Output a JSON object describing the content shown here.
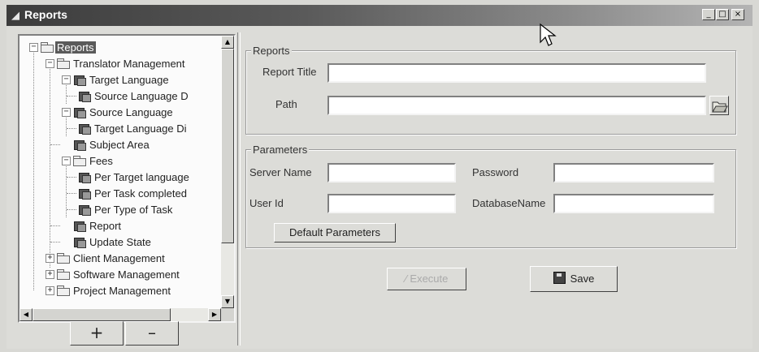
{
  "window": {
    "title": "Reports",
    "controls": [
      "minimize",
      "maximize",
      "close"
    ]
  },
  "tree": {
    "items": [
      {
        "label": "Reports",
        "icon": "folder-icon",
        "selected": true
      },
      {
        "label": "Translator Management",
        "icon": "folder-icon"
      },
      {
        "label": "Target Language",
        "icon": "report-icon"
      },
      {
        "label": "Source Language D",
        "icon": "report-icon"
      },
      {
        "label": "Source Language",
        "icon": "report-icon"
      },
      {
        "label": "Target Language Di",
        "icon": "report-icon"
      },
      {
        "label": "Subject Area",
        "icon": "report-icon"
      },
      {
        "label": "Fees",
        "icon": "folder-icon"
      },
      {
        "label": "Per Target language",
        "icon": "report-icon"
      },
      {
        "label": "Per Task completed",
        "icon": "report-icon"
      },
      {
        "label": "Per Type of Task",
        "icon": "report-icon"
      },
      {
        "label": "Report",
        "icon": "report-icon"
      },
      {
        "label": "Update State",
        "icon": "report-icon"
      },
      {
        "label": "Client Management",
        "icon": "folder-icon"
      },
      {
        "label": "Software Management",
        "icon": "folder-icon"
      },
      {
        "label": "Project Management",
        "icon": "folder-icon"
      }
    ],
    "add_label": "+",
    "remove_label": "–"
  },
  "reports_group": {
    "legend": "Reports",
    "report_title_label": "Report Title",
    "report_title_value": "",
    "path_label": "Path",
    "path_value": ""
  },
  "parameters_group": {
    "legend": "Parameters",
    "server_name_label": "Server Name",
    "server_name_value": "",
    "password_label": "Password",
    "password_value": "",
    "user_id_label": "User Id",
    "user_id_value": "",
    "database_name_label": "DatabaseName",
    "database_name_value": "",
    "default_button": "Default Parameters"
  },
  "actions": {
    "execute": "Execute",
    "save": "Save"
  }
}
